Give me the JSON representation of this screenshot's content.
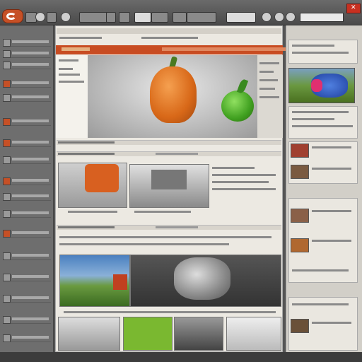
{
  "window": {
    "close_icon": "close-icon"
  },
  "toolbar": {
    "logo_icon": "app-logo-icon",
    "search_placeholder": ""
  },
  "main": {
    "tab_label": "",
    "hero_caption": ""
  },
  "colors": {
    "accent": "#c84c22",
    "chrome": "#555555",
    "content_bg": "#ece9e2"
  }
}
